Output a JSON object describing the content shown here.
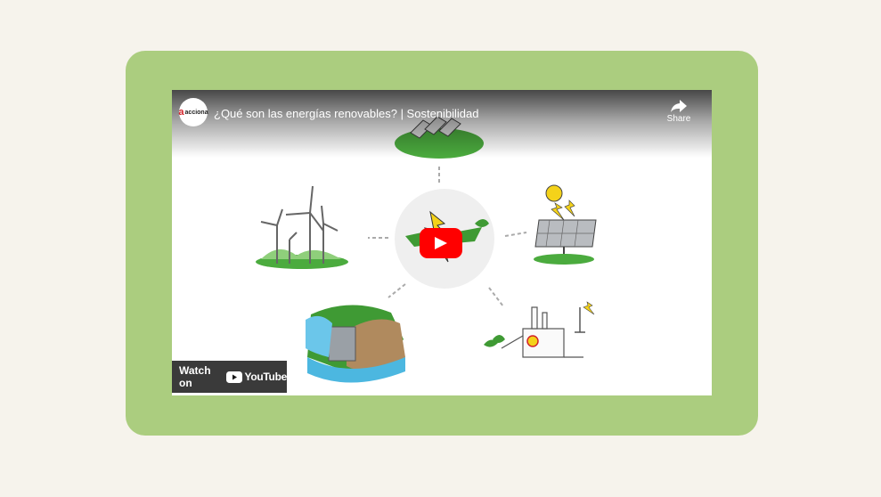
{
  "embed": {
    "channel": "acciona",
    "title": "¿Qué son las energías renovables? | Sostenibilidad",
    "share_label": "Share",
    "watch_on_label": "Watch on",
    "youtube_label": "YouTube"
  },
  "colors": {
    "page_bg": "#f6f3ec",
    "frame": "#abcd7f",
    "youtube_red": "#ff0000",
    "leaf_green": "#3f9a34"
  },
  "icons": [
    "share-icon",
    "play-icon",
    "youtube-logo-icon"
  ]
}
